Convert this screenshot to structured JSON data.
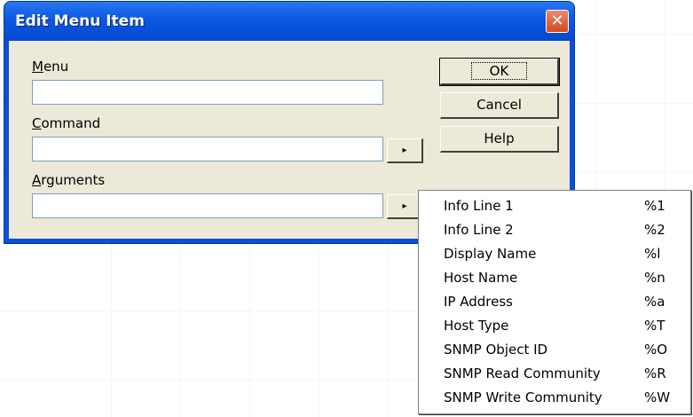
{
  "dialog": {
    "title": "Edit Menu Item",
    "close_glyph": "✕"
  },
  "fields": {
    "menu": {
      "label_accel": "M",
      "label_rest": "enu",
      "value": ""
    },
    "command": {
      "label_accel": "C",
      "label_rest": "ommand",
      "value": ""
    },
    "arguments": {
      "label_accel": "A",
      "label_rest": "rguments",
      "value": ""
    }
  },
  "arrow_glyph": "▸",
  "buttons": {
    "ok": "OK",
    "cancel": "Cancel",
    "help": "Help"
  },
  "popup_menu": {
    "items": [
      {
        "label": "Info Line 1",
        "code": "%1"
      },
      {
        "label": "Info Line 2",
        "code": "%2"
      },
      {
        "label": "Display Name",
        "code": "%l"
      },
      {
        "label": "Host Name",
        "code": "%n"
      },
      {
        "label": "IP Address",
        "code": "%a"
      },
      {
        "label": "Host Type",
        "code": "%T"
      },
      {
        "label": "SNMP Object ID",
        "code": "%O"
      },
      {
        "label": "SNMP Read Community",
        "code": "%R"
      },
      {
        "label": "SNMP Write Community",
        "code": "%W"
      }
    ]
  }
}
